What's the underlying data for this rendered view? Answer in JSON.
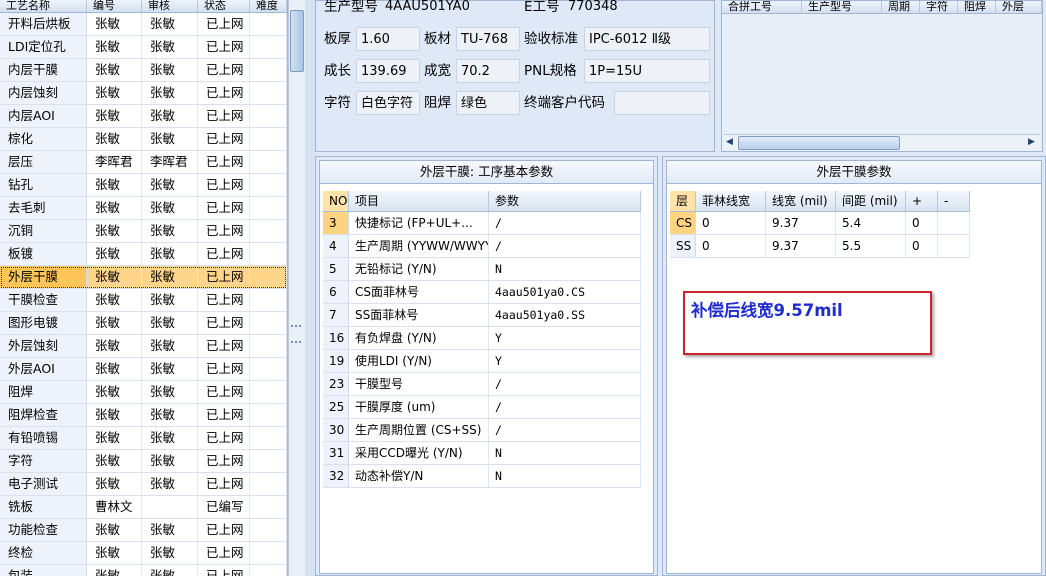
{
  "left_grid": {
    "columns": [
      "工艺名称",
      "编号",
      "审核",
      "状态",
      "难度"
    ],
    "rows": [
      [
        "开料后烘板",
        "张敏",
        "张敏",
        "已上网",
        ""
      ],
      [
        "LDI定位孔",
        "张敏",
        "张敏",
        "已上网",
        ""
      ],
      [
        "内层干膜",
        "张敏",
        "张敏",
        "已上网",
        ""
      ],
      [
        "内层蚀刻",
        "张敏",
        "张敏",
        "已上网",
        ""
      ],
      [
        "内层AOI",
        "张敏",
        "张敏",
        "已上网",
        ""
      ],
      [
        "棕化",
        "张敏",
        "张敏",
        "已上网",
        ""
      ],
      [
        "层压",
        "李晖君",
        "李晖君",
        "已上网",
        ""
      ],
      [
        "钻孔",
        "张敏",
        "张敏",
        "已上网",
        ""
      ],
      [
        "去毛刺",
        "张敏",
        "张敏",
        "已上网",
        ""
      ],
      [
        "沉铜",
        "张敏",
        "张敏",
        "已上网",
        ""
      ],
      [
        "板镀",
        "张敏",
        "张敏",
        "已上网",
        ""
      ],
      [
        "外层干膜",
        "张敏",
        "张敏",
        "已上网",
        ""
      ],
      [
        "干膜检查",
        "张敏",
        "张敏",
        "已上网",
        ""
      ],
      [
        "图形电镀",
        "张敏",
        "张敏",
        "已上网",
        ""
      ],
      [
        "外层蚀刻",
        "张敏",
        "张敏",
        "已上网",
        ""
      ],
      [
        "外层AOI",
        "张敏",
        "张敏",
        "已上网",
        ""
      ],
      [
        "阻焊",
        "张敏",
        "张敏",
        "已上网",
        ""
      ],
      [
        "阻焊检查",
        "张敏",
        "张敏",
        "已上网",
        ""
      ],
      [
        "有铅喷锡",
        "张敏",
        "张敏",
        "已上网",
        ""
      ],
      [
        "字符",
        "张敏",
        "张敏",
        "已上网",
        ""
      ],
      [
        "电子测试",
        "张敏",
        "张敏",
        "已上网",
        ""
      ],
      [
        "铣板",
        "曹林文",
        "",
        "已编写",
        ""
      ],
      [
        "功能检查",
        "张敏",
        "张敏",
        "已上网",
        ""
      ],
      [
        "终检",
        "张敏",
        "张敏",
        "已上网",
        ""
      ],
      [
        "包装",
        "张敏",
        "张敏",
        "已上网",
        ""
      ]
    ],
    "selected_index": 11
  },
  "info": {
    "model_label": "生产型号",
    "model_value": "4AAU501YA0",
    "e_label": "E工号",
    "e_value": "770348",
    "thickness_label": "板厚",
    "thickness_value": "1.60",
    "material_label": "板材",
    "material_value": "TU-768",
    "standard_label": "验收标准",
    "standard_value": "IPC-6012 Ⅱ级",
    "length_label": "成长",
    "length_value": "139.69",
    "width_label": "成宽",
    "width_value": "70.2",
    "pnl_label": "PNL规格",
    "pnl_value": "1P=15U",
    "char_label": "字符",
    "char_value": "白色字符",
    "mask_label": "阻焊",
    "mask_value": "绿色",
    "customer_label": "终端客户代码",
    "customer_value": ""
  },
  "merge_grid": {
    "columns": [
      "合拼工号",
      "生产型号",
      "周期",
      "字符",
      "阻焊",
      "外层"
    ]
  },
  "process_panel": {
    "title": "外层干膜: 工序基本参数",
    "columns": [
      "NO",
      "项目",
      "参数"
    ],
    "rows": [
      [
        "3",
        "快捷标记 (FP+UL+...",
        "/"
      ],
      [
        "4",
        "生产周期 (YYWW/WWYY)",
        "/"
      ],
      [
        "5",
        "无铅标记 (Y/N)",
        "N"
      ],
      [
        "6",
        "CS面菲林号",
        "4aau501ya0.CS"
      ],
      [
        "7",
        "SS面菲林号",
        "4aau501ya0.SS"
      ],
      [
        "16",
        "有负焊盘 (Y/N)",
        "Y"
      ],
      [
        "19",
        "使用LDI (Y/N)",
        "Y"
      ],
      [
        "23",
        "干膜型号",
        "/"
      ],
      [
        "25",
        "干膜厚度 (um)",
        "/"
      ],
      [
        "30",
        "生产周期位置 (CS+SS)",
        "/"
      ],
      [
        "31",
        "采用CCD曝光 (Y/N)",
        "N"
      ],
      [
        "32",
        "动态补偿Y/N",
        "N"
      ]
    ],
    "selected_index": 0
  },
  "film_panel": {
    "title": "外层干膜参数",
    "columns": [
      "层",
      "菲林线宽",
      "线宽 (mil)",
      "间距 (mil)",
      "+",
      "-"
    ],
    "rows": [
      [
        "CS",
        "0",
        "9.37",
        "5.4",
        "0",
        ""
      ],
      [
        "SS",
        "0",
        "9.37",
        "5.5",
        "0",
        ""
      ]
    ],
    "selected_index": 0
  },
  "callout": {
    "text": "补偿后线宽9.57mil",
    "border_color": "#c9252f",
    "text_color": "#1f2bd0"
  },
  "colors": {
    "selection": "#ffd58a",
    "panel_bg": "#dfe8f6",
    "border": "#9fb6d4"
  }
}
